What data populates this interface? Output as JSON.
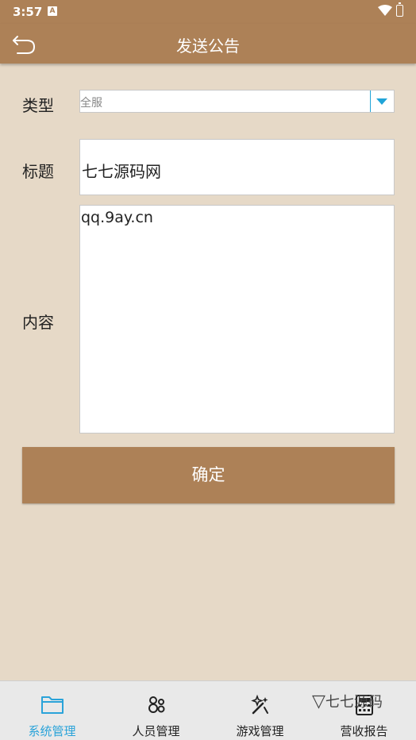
{
  "status_bar": {
    "time": "3:57",
    "notification_icon": "A"
  },
  "header": {
    "title": "发送公告",
    "back_icon": "back-arrow-icon"
  },
  "form": {
    "type_label": "类型",
    "type_value": "全服",
    "title_label": "标题",
    "title_value": "七七源码网",
    "content_label": "内容",
    "content_value": "qq.9ay.cn",
    "submit_label": "确定"
  },
  "bottom_nav": [
    {
      "label": "系统管理",
      "icon": "folder-icon",
      "active": true
    },
    {
      "label": "人员管理",
      "icon": "people-icon",
      "active": false
    },
    {
      "label": "游戏管理",
      "icon": "magic-wand-icon",
      "active": false
    },
    {
      "label": "营收报告",
      "icon": "calculator-icon",
      "active": false
    }
  ],
  "watermark": {
    "text": "七七源码"
  },
  "colors": {
    "primary": "#ad8157",
    "background": "#e6d9c7",
    "active": "#2aa3d9"
  }
}
